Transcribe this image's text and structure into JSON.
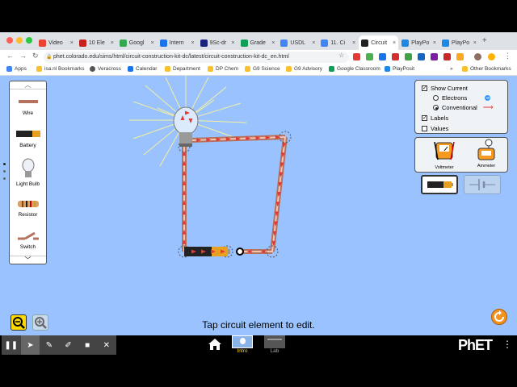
{
  "browser": {
    "tabs": [
      {
        "label": "Video",
        "color": "#ea4335"
      },
      {
        "label": "10 Ele",
        "color": "#c5221f"
      },
      {
        "label": "Googl",
        "color": "#34a853"
      },
      {
        "label": "Intern",
        "color": "#1a73e8"
      },
      {
        "label": "9Sc-dr",
        "color": "#1a237e"
      },
      {
        "label": "Grade",
        "color": "#0f9d58"
      },
      {
        "label": "USDL",
        "color": "#4285f4"
      },
      {
        "label": "11. Ci",
        "color": "#4285f4"
      },
      {
        "label": "Circuit",
        "color": "#222222"
      },
      {
        "label": "PlayPo",
        "color": "#1e88e5"
      },
      {
        "label": "PlayPo",
        "color": "#1e88e5"
      }
    ],
    "active_tab": 8,
    "url": "phet.colorado.edu/sims/html/circuit-construction-kit-dc/latest/circuit-construction-kit-dc_en.html",
    "bookmarks": [
      "Apps",
      "isa.nl Bookmarks",
      "Veracross",
      "Calendar",
      "Department",
      "DP Chem",
      "G9 Science",
      "G9 Advisory",
      "Google Classroom",
      "PlayPosit"
    ],
    "other_bookmarks": "Other Bookmarks"
  },
  "toolbox": {
    "items": [
      "Wire",
      "Battery",
      "Light Bulb",
      "Resistor",
      "Switch"
    ]
  },
  "controls": {
    "show_current": "Show Current",
    "electrons": "Electrons",
    "conventional": "Conventional",
    "labels": "Labels",
    "values": "Values"
  },
  "sensors": {
    "voltmeter": "Voltmeter",
    "ammeter": "Ammeter"
  },
  "hint": "Tap circuit element to edit.",
  "screens": {
    "intro": "Intro",
    "lab": "Lab"
  },
  "brand": "PhET",
  "colors": {
    "sim_bg": "#99c2ff",
    "current_arrow": "#e53935",
    "intro_label": "#ffd900"
  }
}
